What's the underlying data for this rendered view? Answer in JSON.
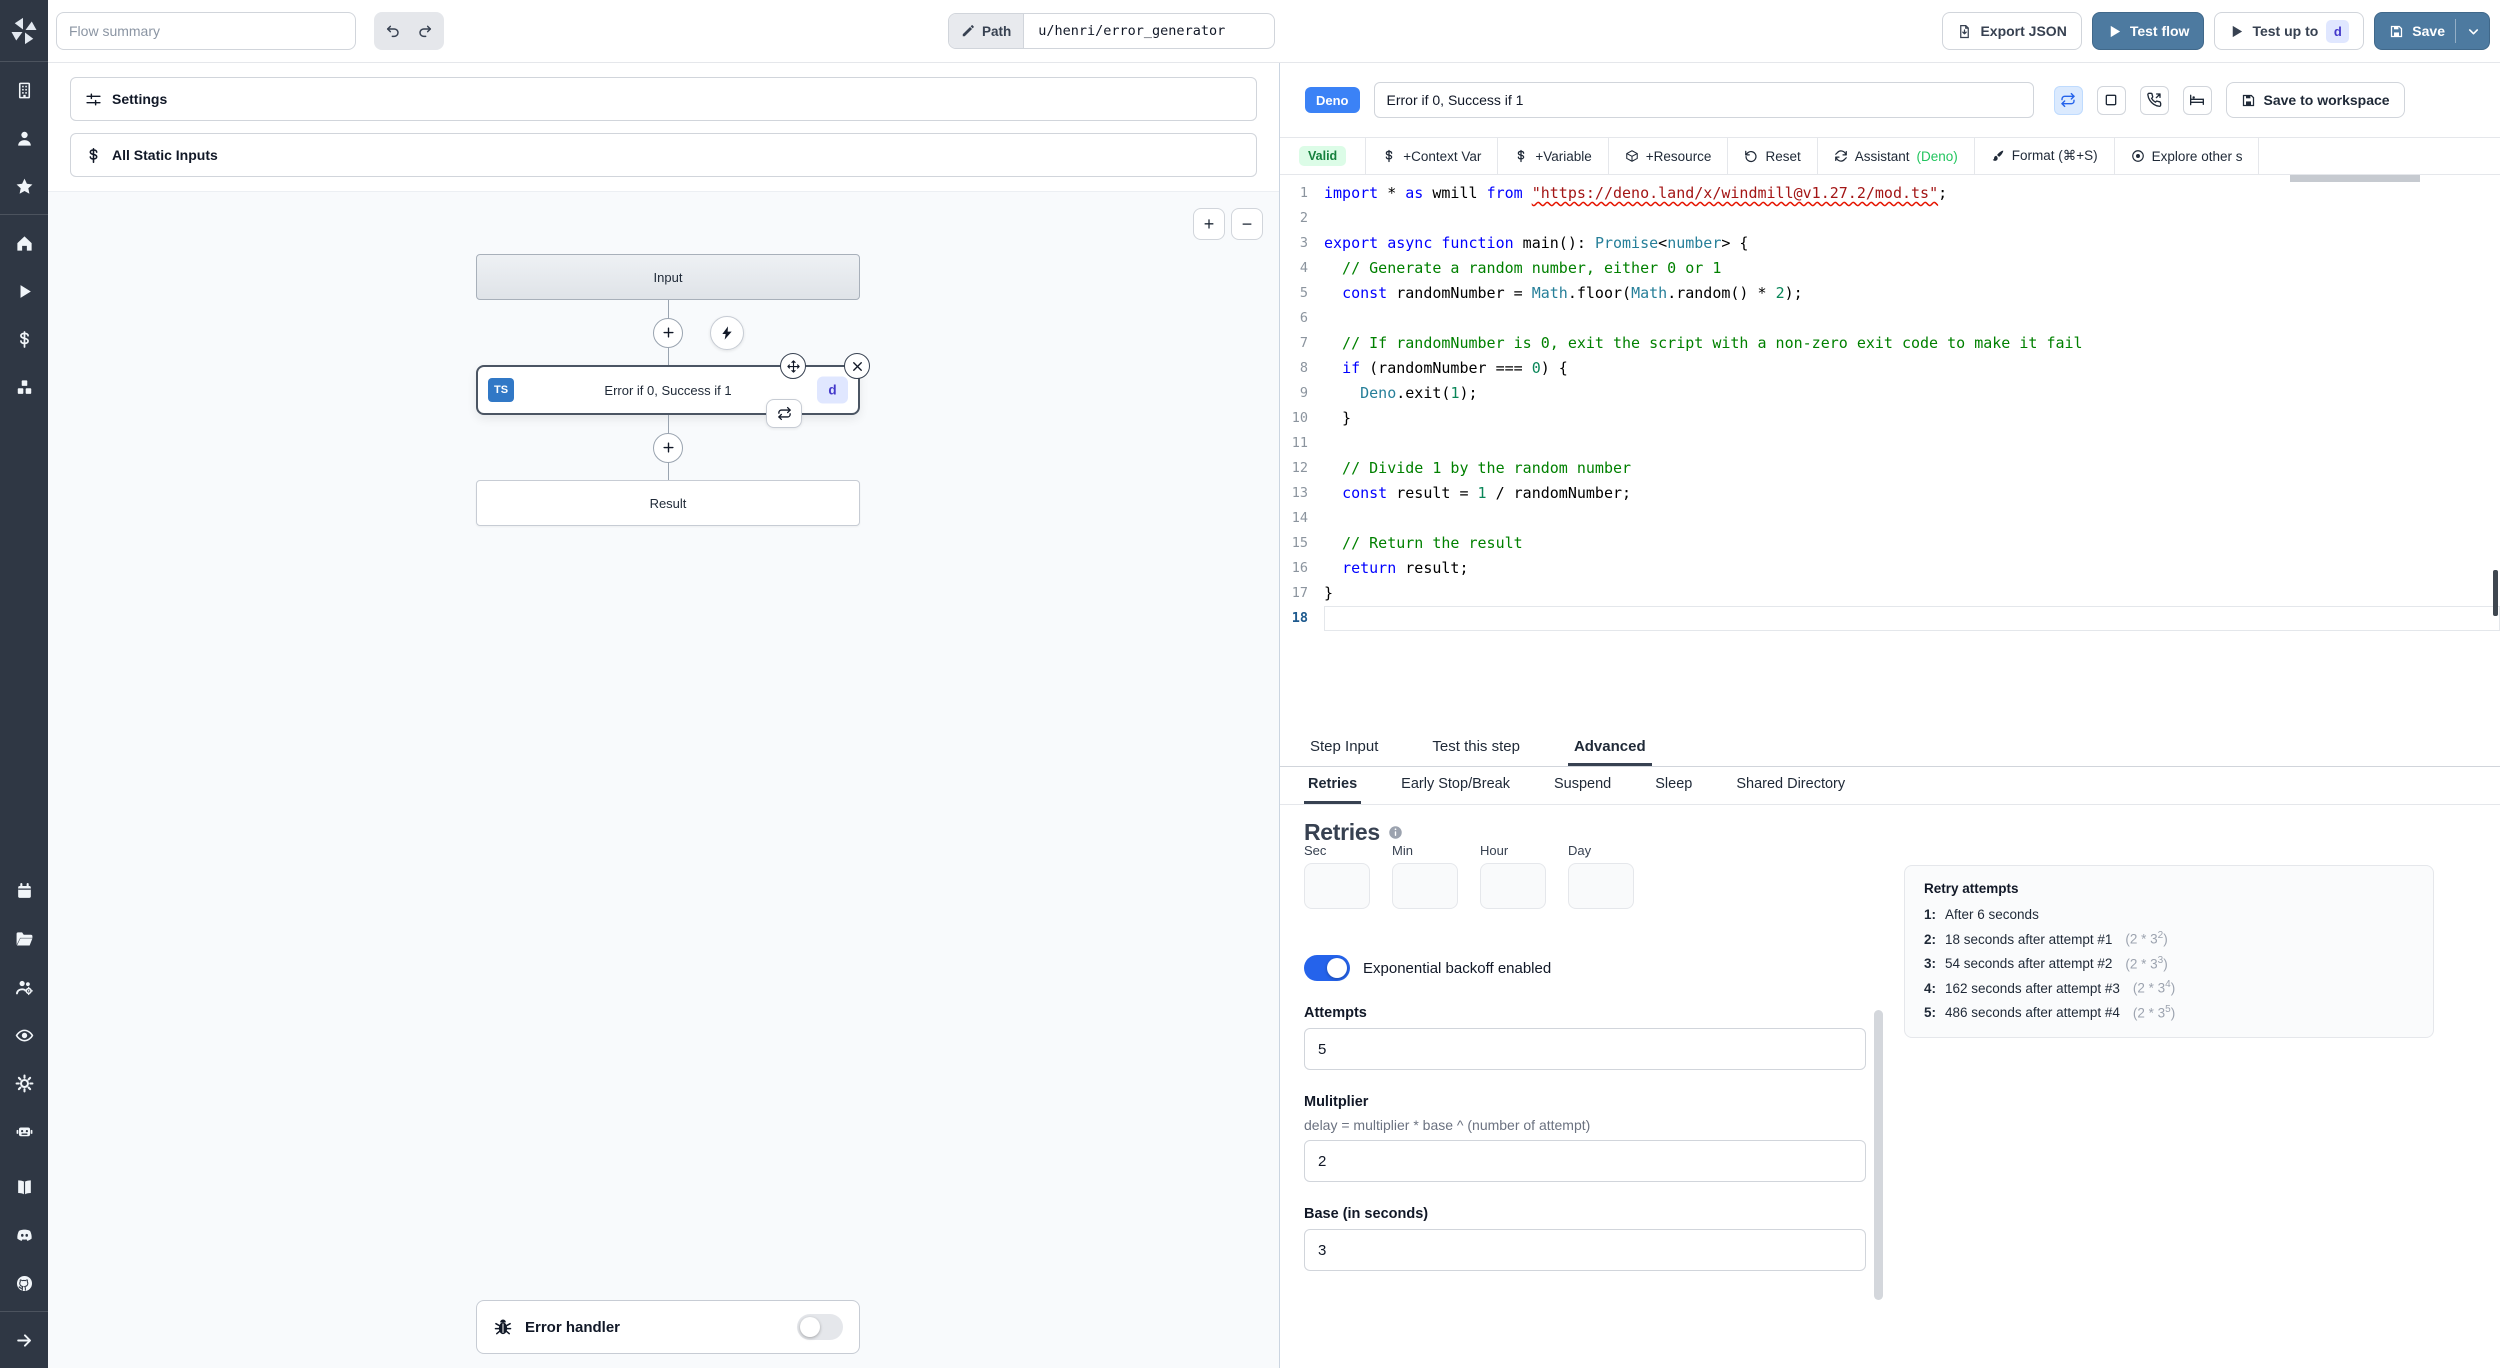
{
  "colors": {
    "sidebar_bg": "#2f3744",
    "primary_button_blue": "#4d7aa0",
    "deno_badge_blue": "#3b82f6",
    "ts_badge_blue": "#3178c6",
    "id_badge_bg": "#e0e7ff",
    "id_badge_text": "#4338ca",
    "valid_badge_bg": "#dcfce7",
    "valid_badge_text": "#15803d",
    "toggle_on_blue": "#2563eb",
    "assistant_accent_green": "#22c55e",
    "canvas_bg": "#f8fafc"
  },
  "sidebar": {
    "logo_icon": "windmill-logo",
    "groups": [
      [
        "building",
        "user",
        "star"
      ],
      [
        "home",
        "play",
        "dollar",
        "boxes"
      ],
      [
        "calendar",
        "folder",
        "users-gear",
        "eye",
        "gear",
        "robot"
      ],
      [
        "book",
        "discord",
        "github"
      ]
    ],
    "bottom_icon": "arrow-right"
  },
  "topbar": {
    "flow_summary_placeholder": "Flow summary",
    "path_label": "Path",
    "path_value": "u/henri/error_generator",
    "export_json_label": "Export JSON",
    "test_flow_label": "Test flow",
    "test_up_to_label": "Test up to",
    "test_up_to_badge": "d",
    "save_label": "Save"
  },
  "flow_panel": {
    "settings_label": "Settings",
    "static_inputs_label": "All Static Inputs",
    "zoom_in": "+",
    "zoom_out": "−",
    "input_node": "Input",
    "step_node_title": "Error if 0, Success if 1",
    "step_lang_badge": "TS",
    "step_id_badge": "d",
    "result_node": "Result",
    "error_handler_label": "Error handler"
  },
  "editor": {
    "lang_badge": "Deno",
    "title_value": "Error if 0, Success if 1",
    "header_icon_buttons": [
      {
        "icon": "repeat",
        "active": true
      },
      {
        "icon": "square",
        "active": false
      },
      {
        "icon": "phone-incoming",
        "active": false
      },
      {
        "icon": "bed",
        "active": false
      }
    ],
    "save_to_workspace_label": "Save to workspace",
    "valid_badge": "Valid",
    "toolbar": [
      {
        "icon": "dollar",
        "label": "+Context Var"
      },
      {
        "icon": "dollar",
        "label": "+Variable"
      },
      {
        "icon": "package",
        "label": "+Resource"
      },
      {
        "icon": "rotate-ccw",
        "label": "Reset"
      },
      {
        "icon": "refresh",
        "label": "Assistant ",
        "accent": "(Deno)"
      },
      {
        "icon": "brush",
        "label": "Format (⌘+S)"
      },
      {
        "icon": "explore",
        "label": "Explore other s"
      }
    ],
    "code_lines": [
      [
        [
          "k",
          "import"
        ],
        [
          "p",
          " * "
        ],
        [
          "k",
          "as"
        ],
        [
          "p",
          " wmill "
        ],
        [
          "k",
          "from"
        ],
        [
          "p",
          " "
        ],
        [
          "su",
          "\"https://deno.land/x/windmill@v1.27.2/mod.ts\""
        ],
        [
          "p",
          ";"
        ]
      ],
      [],
      [
        [
          "k",
          "export"
        ],
        [
          "p",
          " "
        ],
        [
          "k",
          "async"
        ],
        [
          "p",
          " "
        ],
        [
          "k",
          "function"
        ],
        [
          "p",
          " main(): "
        ],
        [
          "t",
          "Promise"
        ],
        [
          "p",
          "<"
        ],
        [
          "t",
          "number"
        ],
        [
          "p",
          "> {"
        ]
      ],
      [
        [
          "c",
          "  // Generate a random number, either 0 or 1"
        ]
      ],
      [
        [
          "p",
          "  "
        ],
        [
          "k",
          "const"
        ],
        [
          "p",
          " randomNumber = "
        ],
        [
          "t",
          "Math"
        ],
        [
          "p",
          ".floor("
        ],
        [
          "t",
          "Math"
        ],
        [
          "p",
          ".random() * "
        ],
        [
          "n",
          "2"
        ],
        [
          "p",
          ");"
        ]
      ],
      [],
      [
        [
          "c",
          "  // If randomNumber is 0, exit the script with a non-zero exit code to make it fail"
        ]
      ],
      [
        [
          "p",
          "  "
        ],
        [
          "k",
          "if"
        ],
        [
          "p",
          " (randomNumber === "
        ],
        [
          "n",
          "0"
        ],
        [
          "p",
          ") {"
        ]
      ],
      [
        [
          "p",
          "    "
        ],
        [
          "t",
          "Deno"
        ],
        [
          "p",
          ".exit("
        ],
        [
          "n",
          "1"
        ],
        [
          "p",
          ");"
        ]
      ],
      [
        [
          "p",
          "  }"
        ]
      ],
      [],
      [
        [
          "c",
          "  // Divide 1 by the random number"
        ]
      ],
      [
        [
          "p",
          "  "
        ],
        [
          "k",
          "const"
        ],
        [
          "p",
          " result = "
        ],
        [
          "n",
          "1"
        ],
        [
          "p",
          " / randomNumber;"
        ]
      ],
      [],
      [
        [
          "c",
          "  // Return the result"
        ]
      ],
      [
        [
          "p",
          "  "
        ],
        [
          "k",
          "return"
        ],
        [
          "p",
          " result;"
        ]
      ],
      [
        [
          "p",
          "}"
        ]
      ],
      []
    ],
    "current_line": 18
  },
  "tabs": {
    "main": [
      "Step Input",
      "Test this step",
      "Advanced"
    ],
    "active_main": "Advanced",
    "sub": [
      "Retries",
      "Early Stop/Break",
      "Suspend",
      "Sleep",
      "Shared Directory"
    ],
    "active_sub": "Retries"
  },
  "retries": {
    "heading": "Retries",
    "time_fields": [
      "Sec",
      "Min",
      "Hour",
      "Day"
    ],
    "backoff_label": "Exponential backoff enabled",
    "backoff_enabled": true,
    "attempts_label": "Attempts",
    "attempts_value": "5",
    "multiplier_label": "Mulitplier",
    "multiplier_hint": "delay = multiplier * base ^ (number of attempt)",
    "multiplier_value": "2",
    "base_label": "Base (in seconds)",
    "base_value": "3",
    "retry_panel": {
      "title": "Retry attempts",
      "items": [
        {
          "n": "1:",
          "text": "After 6 seconds",
          "f": null,
          "e": null
        },
        {
          "n": "2:",
          "text": "18 seconds after attempt #1",
          "f": "2 * 3",
          "e": "2"
        },
        {
          "n": "3:",
          "text": "54 seconds after attempt #2",
          "f": "2 * 3",
          "e": "3"
        },
        {
          "n": "4:",
          "text": "162 seconds after attempt #3",
          "f": "2 * 3",
          "e": "4"
        },
        {
          "n": "5:",
          "text": "486 seconds after attempt #4",
          "f": "2 * 3",
          "e": "5"
        }
      ]
    }
  }
}
